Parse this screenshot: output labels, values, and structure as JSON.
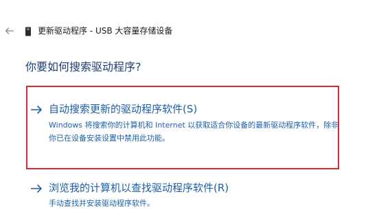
{
  "header": {
    "back_icon": "back-arrow-icon",
    "device_icon": "usb-device-icon",
    "title": "更新驱动程序 - USB 大容量存储设备"
  },
  "page": {
    "question": "你要如何搜索驱动程序?"
  },
  "options": [
    {
      "icon": "arrow-right-icon",
      "title": "自动搜索更新的驱动程序软件(S)",
      "description": "Windows 将搜索你的计算机和 Internet 以获取适合你设备的最新驱动程序软件，除非你已在设备安装设置中禁用此功能。",
      "highlighted": true
    },
    {
      "icon": "arrow-right-icon",
      "title": "浏览我的计算机以查找驱动程序软件(R)",
      "description": "手动查找并安装驱动程序软件。",
      "highlighted": false
    }
  ],
  "colors": {
    "accent": "#1c5fa8",
    "heading": "#1c3f78",
    "highlight_border": "#e0242b"
  }
}
